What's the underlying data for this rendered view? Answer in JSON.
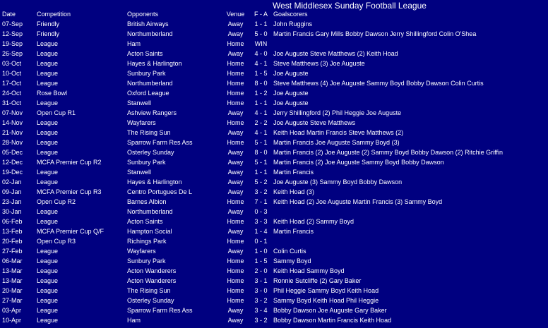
{
  "title": "West Middlesex Sunday Football League",
  "headers": {
    "date": "Date",
    "competition": "Competition",
    "opponents": "Opponents",
    "venue": "Venue",
    "score": "F  -  A",
    "goalscorers": "Goalscorers"
  },
  "rows": [
    {
      "date": "07-Sep",
      "competition": "Friendly",
      "opponents": "British Airways",
      "venue": "Away",
      "score": "1  -  1",
      "goalscorers": "John Ruggins"
    },
    {
      "date": "12-Sep",
      "competition": "Friendly",
      "opponents": "Northumberland",
      "venue": "Away",
      "score": "5  -  0",
      "goalscorers": "Martin Francis Gary Mills Bobby Dawson Jerry Shillingford Colin O'Shea"
    },
    {
      "date": "19-Sep",
      "competition": "League",
      "opponents": "Ham",
      "venue": "Home",
      "score": "WIN",
      "goalscorers": ""
    },
    {
      "date": "26-Sep",
      "competition": "League",
      "opponents": "Acton Saints",
      "venue": "Away",
      "score": "4  -  0",
      "goalscorers": "Joe Auguste Steve Matthews (2) Keith Hoad"
    },
    {
      "date": "03-Oct",
      "competition": "League",
      "opponents": "Hayes & Harlington",
      "venue": "Home",
      "score": "4  -  1",
      "goalscorers": "Steve Matthews (3) Joe Auguste"
    },
    {
      "date": "10-Oct",
      "competition": "League",
      "opponents": "Sunbury Park",
      "venue": "Home",
      "score": "1  -  5",
      "goalscorers": "Joe Auguste"
    },
    {
      "date": "17-Oct",
      "competition": "League",
      "opponents": "Northumberland",
      "venue": "Home",
      "score": "8  -  0",
      "goalscorers": "Steve Matthews (4) Joe Auguste Sammy Boyd Bobby Dawson Colin Curtis"
    },
    {
      "date": "24-Oct",
      "competition": "Rose Bowl",
      "opponents": "Oxford League",
      "venue": "Home",
      "score": "1  -  2",
      "goalscorers": "Joe Auguste"
    },
    {
      "date": "31-Oct",
      "competition": "League",
      "opponents": "Stanwell",
      "venue": "Home",
      "score": "1  -  1",
      "goalscorers": "Joe Auguste"
    },
    {
      "date": "07-Nov",
      "competition": "Open Cup R1",
      "opponents": "Ashview Rangers",
      "venue": "Away",
      "score": "4  -  1",
      "goalscorers": "Jerry Shillingford (2) Phil Heggie Joe Auguste"
    },
    {
      "date": "14-Nov",
      "competition": "League",
      "opponents": "Wayfarers",
      "venue": "Home",
      "score": "2  -  2",
      "goalscorers": "Joe Auguste Steve Matthews"
    },
    {
      "date": "21-Nov",
      "competition": "League",
      "opponents": "The Rising Sun",
      "venue": "Away",
      "score": "4  -  1",
      "goalscorers": "Keith Hoad Martin Francis Steve Matthews (2)"
    },
    {
      "date": "28-Nov",
      "competition": "League",
      "opponents": "Sparrow Farm Res Ass",
      "venue": "Home",
      "score": "5  -  1",
      "goalscorers": "Martin Francis Joe Auguste Sammy Boyd (3)"
    },
    {
      "date": "05-Dec",
      "competition": "League",
      "opponents": "Osterley Sunday",
      "venue": "Away",
      "score": "8  -  0",
      "goalscorers": "Martin Francis (2) Joe Auguste (2) Sammy Boyd Bobby Dawson (2) Ritchie Griffin"
    },
    {
      "date": "12-Dec",
      "competition": "MCFA Premier Cup R2",
      "opponents": "Sunbury Park",
      "venue": "Away",
      "score": "5  -  1",
      "goalscorers": "Martin Francis (2) Joe Auguste Sammy Boyd Bobby Dawson"
    },
    {
      "date": "19-Dec",
      "competition": "League",
      "opponents": "Stanwell",
      "venue": "Away",
      "score": "1  -  1",
      "goalscorers": "Martin Francis"
    },
    {
      "date": "02-Jan",
      "competition": "League",
      "opponents": "Hayes & Harlington",
      "venue": "Away",
      "score": "5  -  2",
      "goalscorers": "Joe Auguste (3) Sammy Boyd Bobby Dawson"
    },
    {
      "date": "09-Jan",
      "competition": "MCFA Premier Cup R3",
      "opponents": "Centro Portugues De L",
      "venue": "Away",
      "score": "3  -  2",
      "goalscorers": "Keith Hoad (3)"
    },
    {
      "date": "23-Jan",
      "competition": "Open Cup R2",
      "opponents": "Barnes Albion",
      "venue": "Home",
      "score": "7  -  1",
      "goalscorers": "Keith Hoad (2) Joe Auguste Martin Francis (3) Sammy Boyd"
    },
    {
      "date": "30-Jan",
      "competition": "League",
      "opponents": "Northumberland",
      "venue": "Away",
      "score": "0  -  3",
      "goalscorers": ""
    },
    {
      "date": "06-Feb",
      "competition": "League",
      "opponents": "Acton Saints",
      "venue": "Home",
      "score": "3  -  3",
      "goalscorers": "Keith Hoad (2) Sammy Boyd"
    },
    {
      "date": "13-Feb",
      "competition": "MCFA Premier Cup Q/F",
      "opponents": "Hampton Social",
      "venue": "Away",
      "score": "1  -  4",
      "goalscorers": "Martin Francis"
    },
    {
      "date": "20-Feb",
      "competition": "Open Cup R3",
      "opponents": "Richings Park",
      "venue": "Home",
      "score": "0  -  1",
      "goalscorers": ""
    },
    {
      "date": "27-Feb",
      "competition": "League",
      "opponents": "Wayfarers",
      "venue": "Away",
      "score": "1  -  0",
      "goalscorers": "Colin Curtis"
    },
    {
      "date": "06-Mar",
      "competition": "League",
      "opponents": "Sunbury Park",
      "venue": "Home",
      "score": "1  -  5",
      "goalscorers": "Sammy Boyd"
    },
    {
      "date": "13-Mar",
      "competition": "League",
      "opponents": "Acton Wanderers",
      "venue": "Home",
      "score": "2  -  0",
      "goalscorers": "Keith Hoad Sammy Boyd"
    },
    {
      "date": "13-Mar",
      "competition": "League",
      "opponents": "Acton Wanderers",
      "venue": "Home",
      "score": "3  -  1",
      "goalscorers": "Ronnie Sutcliffe (2) Gary Baker"
    },
    {
      "date": "20-Mar",
      "competition": "League",
      "opponents": "The Rising Sun",
      "venue": "Home",
      "score": "3  -  0",
      "goalscorers": "Phil Heggie Sammy Boyd Keith Hoad"
    },
    {
      "date": "27-Mar",
      "competition": "League",
      "opponents": "Osterley Sunday",
      "venue": "Home",
      "score": "3  -  2",
      "goalscorers": "Sammy Boyd Keith Hoad Phil Heggie"
    },
    {
      "date": "03-Apr",
      "competition": "League",
      "opponents": "Sparrow Farm Res Ass",
      "venue": "Away",
      "score": "3  -  4",
      "goalscorers": "Bobby Dawson Joe Auguste Gary Baker"
    },
    {
      "date": "10-Apr",
      "competition": "League",
      "opponents": "Ham",
      "venue": "Away",
      "score": "3  -  2",
      "goalscorers": "Bobby Dawson Martin Francis Keith Hoad"
    }
  ]
}
